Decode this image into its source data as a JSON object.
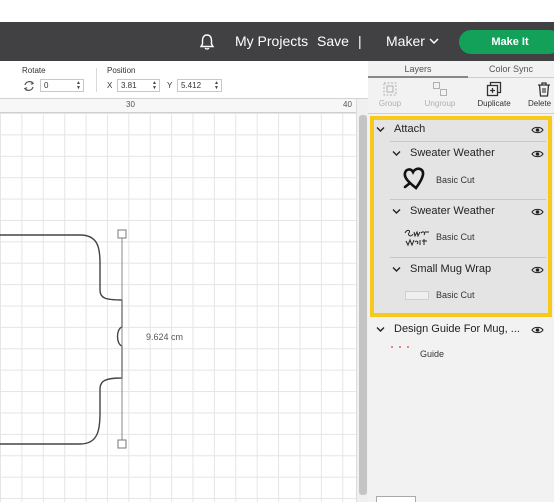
{
  "header": {
    "my_projects": "My Projects",
    "save": "Save",
    "separator": "|",
    "machine": "Maker",
    "make_it": "Make It",
    "bell_icon": "bell-icon"
  },
  "toolbar": {
    "rotate_label": "Rotate",
    "rotate_value": "0",
    "position_label": "Position",
    "x_label": "X",
    "x_value": "3.81",
    "y_label": "Y",
    "y_value": "5.412"
  },
  "ruler": {
    "marks": [
      "30",
      "40"
    ]
  },
  "canvas": {
    "dimension_label": "9.624 cm"
  },
  "panel": {
    "tabs": [
      "Layers",
      "Color Sync"
    ],
    "actions": [
      {
        "label": "Group",
        "enabled": false,
        "icon": "group-icon"
      },
      {
        "label": "Ungroup",
        "enabled": false,
        "icon": "ungroup-icon"
      },
      {
        "label": "Duplicate",
        "enabled": true,
        "icon": "duplicate-icon"
      },
      {
        "label": "Delete",
        "enabled": true,
        "icon": "trash-icon"
      }
    ],
    "attach_group": {
      "label": "Attach",
      "children": [
        {
          "name": "Sweater Weather",
          "operation": "Basic Cut",
          "thumb": "heart-outline"
        },
        {
          "name": "Sweater Weather",
          "operation": "Basic Cut",
          "thumb": "script-text"
        },
        {
          "name": "Small Mug Wrap",
          "operation": "Basic Cut",
          "thumb": "blank-rectangle"
        }
      ]
    },
    "guide_group": {
      "label": "Design Guide For Mug, ...",
      "operation": "Guide"
    },
    "highlight_color": "#f6c91a"
  },
  "colors": {
    "header_bg": "#414143",
    "make_it": "#13a15a",
    "highlight": "#f6c91a"
  }
}
